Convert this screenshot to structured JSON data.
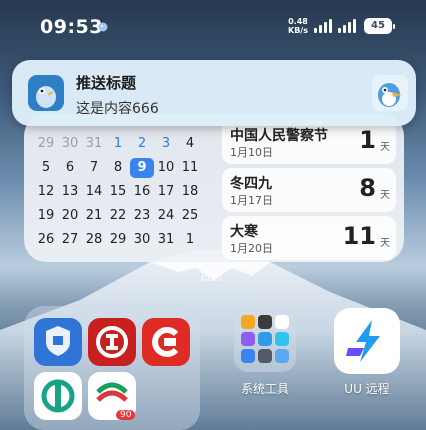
{
  "status_bar": {
    "time": "09:53",
    "net_speed_value": "0.48",
    "net_speed_unit": "KB/s",
    "battery": "45"
  },
  "notification": {
    "title": "推送标题",
    "body": "这是内容666"
  },
  "calendar": {
    "weeks": [
      [
        "29",
        "30",
        "31",
        "1",
        "2",
        "3",
        "4"
      ],
      [
        "5",
        "6",
        "7",
        "8",
        "9",
        "10",
        "11"
      ],
      [
        "12",
        "13",
        "14",
        "15",
        "16",
        "17",
        "18"
      ],
      [
        "19",
        "20",
        "21",
        "22",
        "23",
        "24",
        "25"
      ],
      [
        "26",
        "27",
        "28",
        "29",
        "30",
        "31",
        "1"
      ]
    ],
    "today": "9",
    "events": [
      {
        "title": "中国人民警察节",
        "date": "1月10日",
        "days": "1",
        "unit": "天"
      },
      {
        "title": "冬四九",
        "date": "1月17日",
        "days": "8",
        "unit": "天"
      },
      {
        "title": "大寒",
        "date": "1月20日",
        "days": "11",
        "unit": "天"
      }
    ],
    "caption": "日历"
  },
  "home": {
    "tools_folder_label": "系统工具",
    "uu_label": "UU 远程",
    "badge": "90"
  },
  "colors": {
    "accent": "#3a84f0",
    "notification_bg": "#deeefa"
  }
}
